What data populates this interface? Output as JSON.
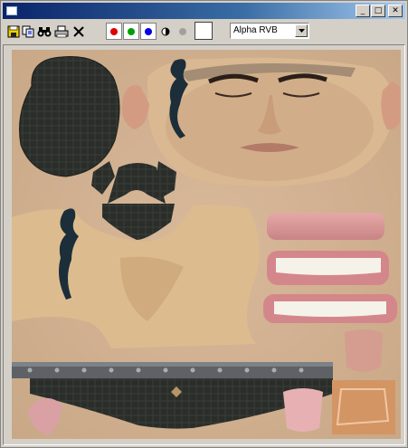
{
  "window": {
    "title": "",
    "buttons": [
      "_",
      "□",
      "✕"
    ]
  },
  "toolbar": {
    "icons": [
      "save-icon",
      "copy-icon",
      "binoculars-icon",
      "print-icon",
      "delete-icon"
    ],
    "channels": [
      {
        "name": "red-channel",
        "color": "#e00000"
      },
      {
        "name": "green-channel",
        "color": "#00a000"
      },
      {
        "name": "blue-channel",
        "color": "#0000e0"
      }
    ],
    "alpha_select": {
      "value": "Alpha RVB"
    }
  },
  "texture": {
    "skin_color": "#d2b292",
    "tattoo_color": "#1c2e3a",
    "cloth_color": "#2a2d29"
  }
}
